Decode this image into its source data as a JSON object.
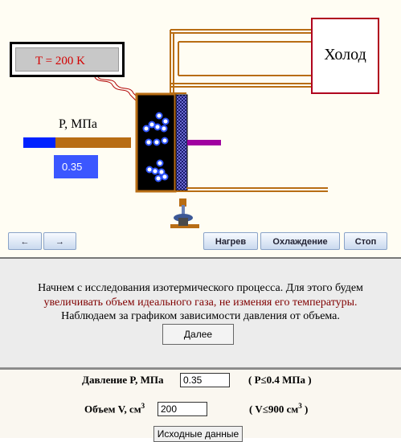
{
  "simulation": {
    "temperature_label": "T = 200 K",
    "cold_label": "Холод",
    "pressure_label": "P, МПа",
    "pressure_value": "0.35",
    "pressure_bar_fraction": 0.3
  },
  "controls": {
    "back_label": "←",
    "forward_label": "→",
    "heat_label": "Нагрев",
    "cool_label": "Охлаждение",
    "stop_label": "Стоп"
  },
  "description": {
    "line1": "Начнем с исследования изотермического процесса. Для этого будем",
    "line2": "увеличивать объем идеального газа, не изменяя его температуры.",
    "line3": "Наблюдаем за графиком зависимости давления от объема.",
    "next_label": "Далее"
  },
  "inputs": {
    "pressure_label": "Давление P, МПа",
    "pressure_value": "0.35",
    "pressure_limit": "( P≤0.4 МПа )",
    "volume_label": "Объем V, см",
    "volume_sup": "3",
    "volume_value": "200",
    "volume_limit": "( V≤900 см",
    "volume_limit_sup": "3",
    "volume_limit_end": " )",
    "initial_data_label": "Исходные данные"
  },
  "colors": {
    "gas_dot": "#2f55ff",
    "piston_rod": "#a000a0",
    "frame": "#b86d14",
    "bar_blue": "#0022ff",
    "bar_brown": "#b86d14"
  }
}
